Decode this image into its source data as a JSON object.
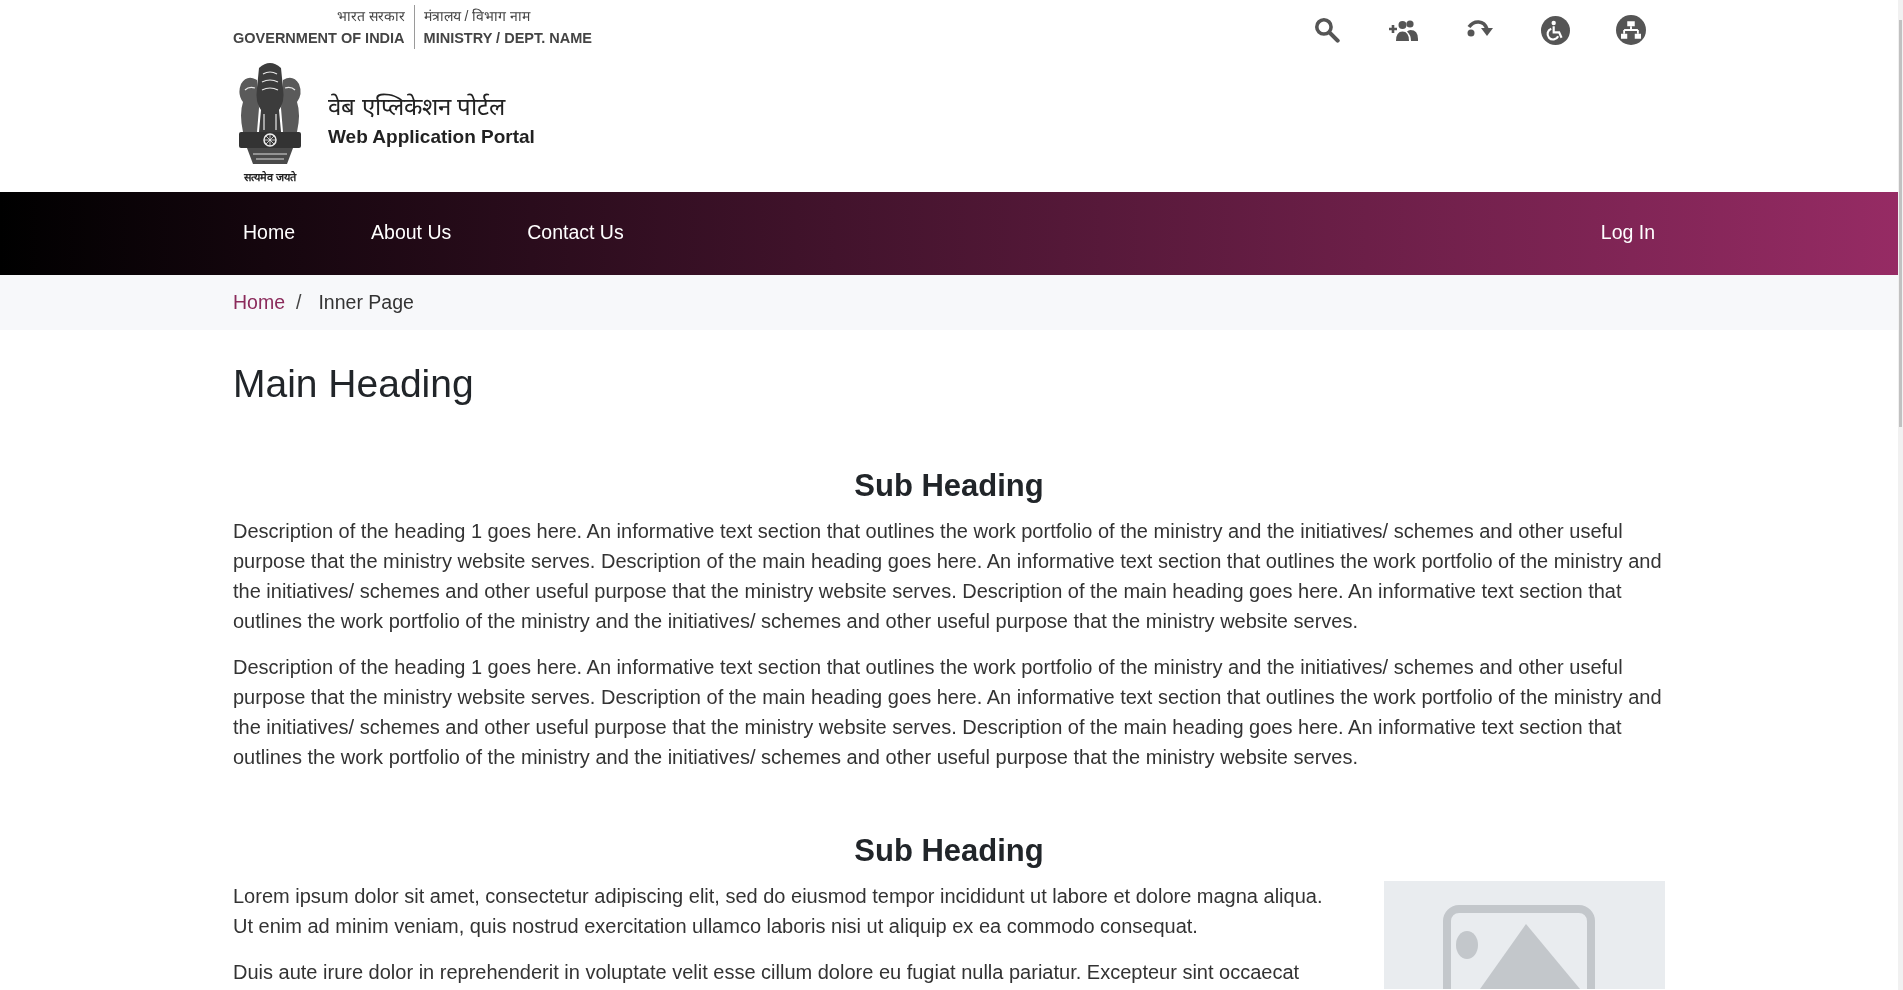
{
  "header": {
    "government": {
      "hindi": "भारत सरकार",
      "english": "GOVERNMENT OF INDIA"
    },
    "ministry": {
      "hindi": "मंत्रालय / विभाग नाम",
      "english": "MINISTRY / DEPT. NAME"
    },
    "emblem_motto": "सत्यमेव जयते",
    "portal_title_hindi": "वेब एप्लिकेशन पोर्टल",
    "portal_title": "Web Application Portal"
  },
  "nav": {
    "links": [
      "Home",
      "About Us",
      "Contact Us"
    ],
    "login": "Log In"
  },
  "breadcrumb": {
    "items": [
      {
        "label": "Home",
        "kind": "link"
      },
      {
        "label": "Inner Page",
        "kind": "current"
      }
    ],
    "separator": "/"
  },
  "main_heading": "Main Heading",
  "sections": [
    {
      "kind": "plain",
      "heading": "Sub Heading",
      "paragraphs": [
        "Description of the heading 1 goes here. An informative text section that outlines the work portfolio of the ministry and the initiatives/ schemes and other useful purpose that the ministry website serves. Description of the main heading goes here. An informative text section that outlines the work portfolio of the ministry and the initiatives/ schemes and other useful purpose that the ministry website serves. Description of the main heading goes here. An informative text section that outlines the work portfolio of the ministry and the initiatives/ schemes and other useful purpose that the ministry website serves.",
        "Description of the heading 1 goes here. An informative text section that outlines the work portfolio of the ministry and the initiatives/ schemes and other useful purpose that the ministry website serves. Description of the main heading goes here. An informative text section that outlines the work portfolio of the ministry and the initiatives/ schemes and other useful purpose that the ministry website serves. Description of the main heading goes here. An informative text section that outlines the work portfolio of the ministry and the initiatives/ schemes and other useful purpose that the ministry website serves."
      ]
    },
    {
      "kind": "illustrated",
      "heading": "Sub Heading",
      "paragraphs": [
        "Lorem ipsum dolor sit amet, consectetur adipiscing elit, sed do eiusmod tempor incididunt ut labore et dolore magna aliqua. Ut enim ad minim veniam, quis nostrud exercitation ullamco laboris nisi ut aliquip ex ea commodo consequat.",
        "Duis aute irure dolor in reprehenderit in voluptate velit esse cillum dolore eu fugiat nulla pariatur. Excepteur sint occaecat"
      ]
    }
  ]
}
